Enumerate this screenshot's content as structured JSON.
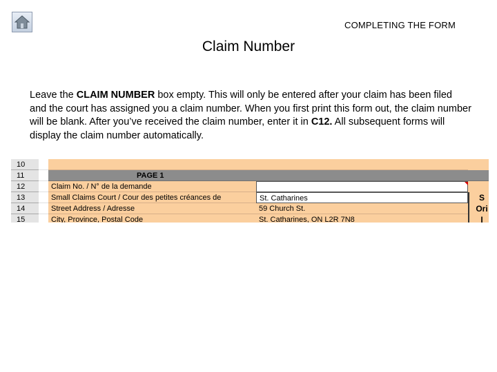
{
  "header": {
    "section_label": "COMPLETING THE FORM",
    "title": "Claim Number"
  },
  "icons": {
    "home": "home-icon"
  },
  "body": {
    "t1": "Leave the ",
    "b1": "CLAIM NUMBER",
    "t2": " box empty. This will only be entered after your claim has been filed and the court has assigned you a claim number. When you first print this form out, the claim number will be blank. After you’ve received the claim number, enter it in ",
    "b2": "C12.",
    "t3": " All subsequent forms will display the claim number automatically."
  },
  "sheet": {
    "rows": [
      {
        "num": "10",
        "b": "",
        "c": "",
        "d": ""
      },
      {
        "num": "11",
        "b": "PAGE 1",
        "c": "",
        "d": ""
      },
      {
        "num": "12",
        "b": "Claim No. / N° de la demande",
        "c": "",
        "d": ""
      },
      {
        "num": "13",
        "b": "Small Claims Court / Cour des petites créances de",
        "c": "St. Catharines",
        "d": "S"
      },
      {
        "num": "14",
        "b": "Street Address / Adresse",
        "c": "59 Church St.",
        "d": "Ori"
      },
      {
        "num": "15",
        "b": "City, Province, Postal Code",
        "c": "St. Catharines, ON  L2R 7N8",
        "d": "I"
      }
    ]
  },
  "colors": {
    "cell_fill": "#fbcf9e",
    "header_bar": "#8c8c8c",
    "marker": "#d40000"
  }
}
